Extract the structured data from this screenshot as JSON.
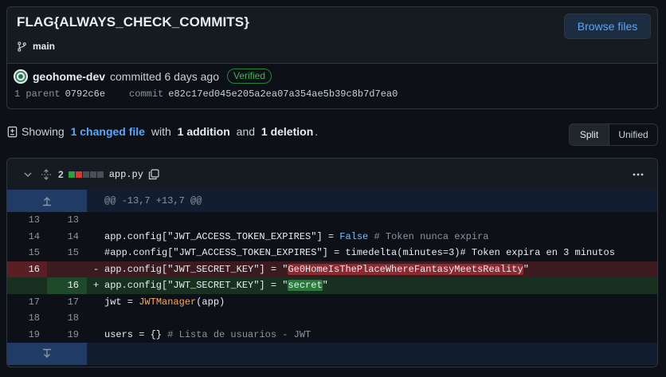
{
  "commit": {
    "title": "FLAG{ALWAYS_CHECK_COMMITS}",
    "branch": "main",
    "browse_label": "Browse files",
    "author": "geohome-dev",
    "committed_text": "committed 6 days ago",
    "verified_label": "Verified",
    "parent_label": "1 parent",
    "parent_sha": "0792c6e",
    "commit_label": "commit",
    "commit_sha": "e82c17ed045e205a2ea07a354ae5b39c8b7d7ea0"
  },
  "summary": {
    "showing": "Showing",
    "changed": "1 changed file",
    "with": "with",
    "additions": "1 addition",
    "and": "and",
    "deletions": "1 deletion",
    "period": "."
  },
  "view_toggle": {
    "split": "Split",
    "unified": "Unified"
  },
  "file": {
    "count": "2",
    "name": "app.py",
    "block_colors": [
      "#2ea043",
      "#da3633",
      "#484f58",
      "#484f58",
      "#484f58"
    ]
  },
  "diff": {
    "hunk_header": "@@ -13,7 +13,7 @@",
    "lines": [
      {
        "old": "13",
        "new": "13",
        "sign": "",
        "type": "ctx"
      },
      {
        "old": "14",
        "new": "14",
        "sign": "",
        "type": "ctx"
      },
      {
        "old": "15",
        "new": "15",
        "sign": "",
        "type": "ctx"
      },
      {
        "old": "16",
        "new": "",
        "sign": "-",
        "type": "del"
      },
      {
        "old": "",
        "new": "16",
        "sign": "+",
        "type": "add"
      },
      {
        "old": "17",
        "new": "17",
        "sign": "",
        "type": "ctx"
      },
      {
        "old": "18",
        "new": "18",
        "sign": "",
        "type": "ctx"
      },
      {
        "old": "19",
        "new": "19",
        "sign": "",
        "type": "ctx"
      }
    ],
    "code": {
      "l14_a": "app.config[\"JWT_ACCESS_TOKEN_EXPIRES\"] = ",
      "l14_kw": "False",
      "l14_cm": " # Token nunca expira",
      "l15": "#app.config[\"JWT_ACCESS_TOKEN_EXPIRES\"] = timedelta(minutes=3)# Token expira en 3 minutos",
      "l16_a": "app.config[\"JWT_SECRET_KEY\"] = \"",
      "l16_hl": "Ge0HomeIsThePlaceWhereFantasyMeetsReality",
      "l16_b": "\"",
      "l16n_a": "app.config[\"JWT_SECRET_KEY\"] = \"",
      "l16n_hl": "secret",
      "l16n_b": "\"",
      "l17_a": "jwt = ",
      "l17_fn": "JWTManager",
      "l17_b": "(app)",
      "l19_a": "users = {} ",
      "l19_cm": "# Lista de usuarios - JWT"
    }
  }
}
